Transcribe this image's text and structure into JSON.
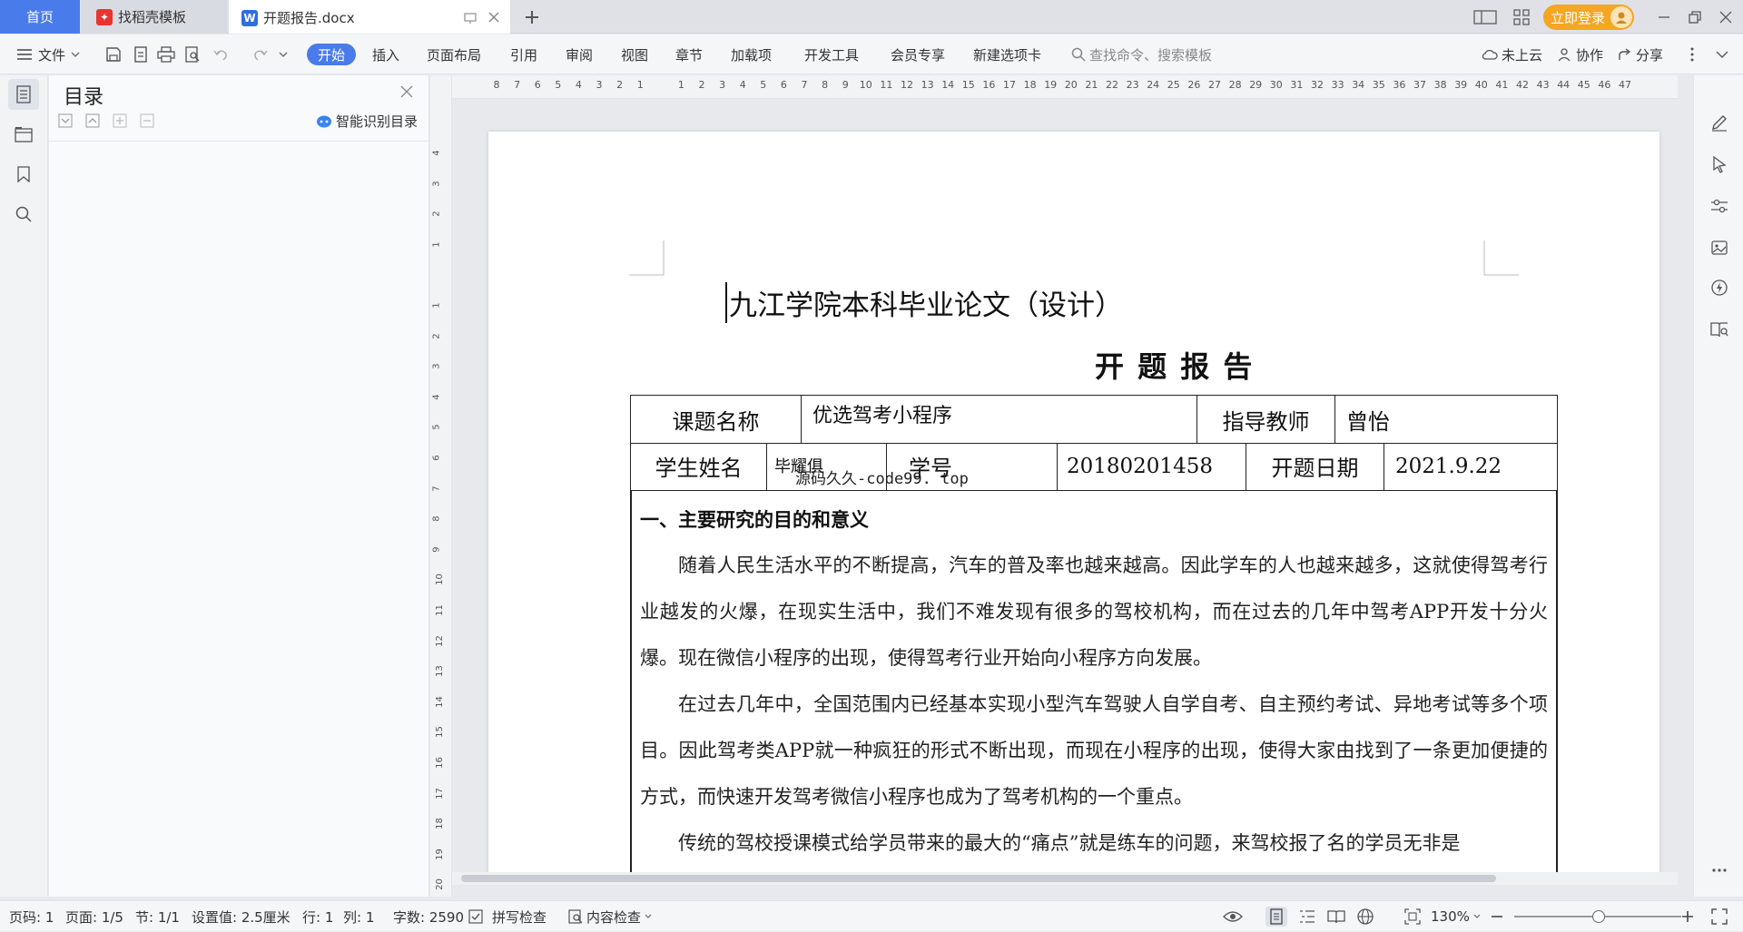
{
  "tabs": {
    "home": "首页",
    "daoke": "找稻壳模板",
    "doc": "开题报告.docx"
  },
  "header": {
    "login": "立即登录"
  },
  "toolbar": {
    "file": "文件",
    "menus": [
      "开始",
      "插入",
      "页面布局",
      "引用",
      "审阅",
      "视图",
      "章节",
      "加载项",
      "开发工具",
      "会员专享",
      "新建选项卡"
    ],
    "search_placeholder": "查找命令、搜索模板",
    "cloud": "未上云",
    "collab": "协作",
    "share": "分享"
  },
  "toc": {
    "title": "目录",
    "smart": "智能识别目录"
  },
  "ruler": {
    "h_ticks": [
      "8",
      "7",
      "6",
      "5",
      "4",
      "3",
      "2",
      "1",
      "",
      "1",
      "2",
      "3",
      "4",
      "5",
      "6",
      "7",
      "8",
      "9",
      "10",
      "11",
      "12",
      "13",
      "14",
      "15",
      "16",
      "17",
      "18",
      "19",
      "20",
      "21",
      "22",
      "23",
      "24",
      "25",
      "26",
      "27",
      "28",
      "29",
      "30",
      "31",
      "32",
      "33",
      "34",
      "35",
      "36",
      "37",
      "38",
      "39",
      "40",
      "41",
      "42",
      "43",
      "44",
      "45",
      "46",
      "47"
    ],
    "v_ticks": [
      "4",
      "3",
      "2",
      "1",
      "",
      "1",
      "2",
      "3",
      "4",
      "5",
      "6",
      "7",
      "8",
      "9",
      "10",
      "11",
      "12",
      "13",
      "14",
      "15",
      "16",
      "17",
      "18",
      "19",
      "20"
    ]
  },
  "document": {
    "title": "九江学院本科毕业论文（设计）",
    "subtitle": "开 题 报 告",
    "table": {
      "topic_label": "课题名称",
      "topic": "优选驾考小程序",
      "advisor_label": "指导教师",
      "advisor": "曾怡",
      "student_label": "学生姓名",
      "student": "毕耀俱",
      "id_label": "学号",
      "id": "20180201458",
      "date_label": "开题日期",
      "date": "2021.9.22"
    },
    "watermark": "源码久久-code99. top",
    "section1": "一、主要研究的目的和意义",
    "paragraphs": [
      "随着人民生活水平的不断提高，汽车的普及率也越来越高。因此学车的人也越来越多，这就使得驾考行业越发的火爆，在现实生活中，我们不难发现有很多的驾校机构，而在过去的几年中驾考APP开发十分火爆。现在微信小程序的出现，使得驾考行业开始向小程序方向发展。",
      "在过去几年中，全国范围内已经基本实现小型汽车驾驶人自学自考、自主预约考试、异地考试等多个项目。因此驾考类APP就一种疯狂的形式不断出现，而现在小程序的出现，使得大家由找到了一条更加便捷的方式，而快速开发驾考微信小程序也成为了驾考机构的一个重点。",
      "传统的驾校授课模式给学员带来的最大的“痛点”就是练车的问题，来驾校报了名的学员无非是"
    ]
  },
  "status": {
    "page_code": "页码: 1",
    "pages": "页面: 1/5",
    "section": "节: 1/1",
    "setting": "设置值: 2.5厘米",
    "row": "行: 1",
    "col": "列: 1",
    "words": "字数: 2590",
    "spell": "拼写检查",
    "content": "内容检查",
    "zoom": "130%"
  },
  "colors": {
    "accent": "#4a7bea",
    "login": "#f5a623"
  }
}
